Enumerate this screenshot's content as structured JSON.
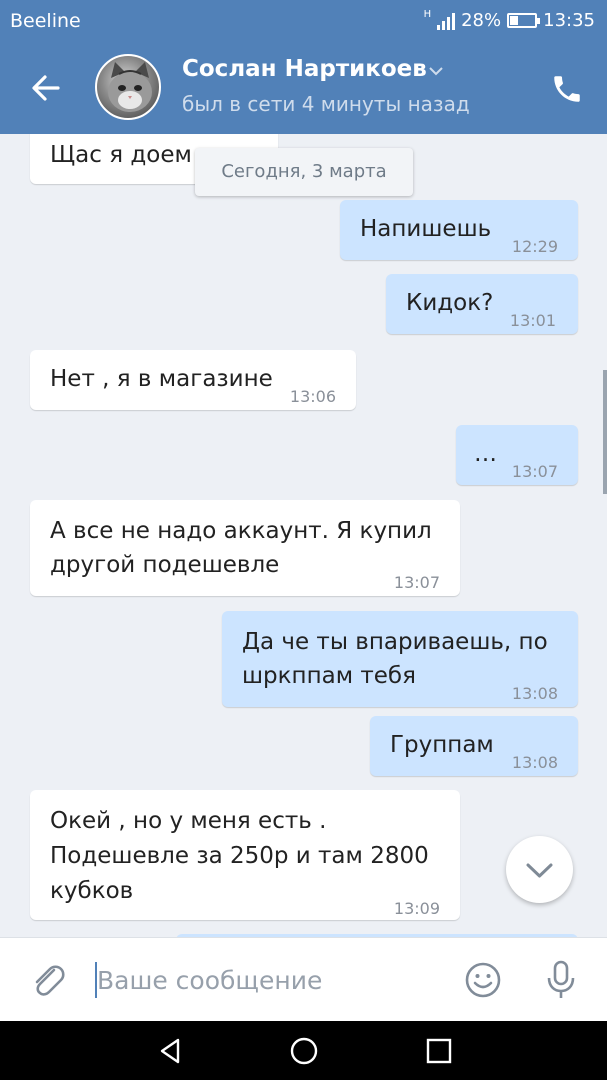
{
  "status_bar": {
    "carrier": "Beeline",
    "network": "H",
    "battery": "28%",
    "time": "13:35"
  },
  "header": {
    "contact_name": "Сослан Нартикоев",
    "last_seen": "был в сети 4 минуты назад",
    "icons": [
      "back-arrow-icon",
      "chevron-down-icon",
      "phone-icon"
    ]
  },
  "chat": {
    "date_divider": "Сегодня, 3 марта",
    "messages": [
      {
        "direction": "in",
        "lines": [
          "Щас я доем"
        ],
        "time": ""
      },
      {
        "direction": "out",
        "lines": [
          "Напишешь"
        ],
        "time": "12:29"
      },
      {
        "direction": "out",
        "lines": [
          "Кидок?"
        ],
        "time": "13:01"
      },
      {
        "direction": "in",
        "lines": [
          "Нет , я в магазине"
        ],
        "time": "13:06"
      },
      {
        "direction": "out",
        "lines": [
          "…"
        ],
        "time": "13:07"
      },
      {
        "direction": "in",
        "lines": [
          "А все не надо аккаунт. Я купил",
          "другой подешевле"
        ],
        "time": "13:07"
      },
      {
        "direction": "out",
        "lines": [
          "Да че ты впариваешь, по",
          "шркппам тебя"
        ],
        "time": "13:08"
      },
      {
        "direction": "out",
        "lines": [
          "Группам"
        ],
        "time": "13:08"
      },
      {
        "direction": "in",
        "lines": [
          "Окей , но у меня есть .",
          "Подешевле за 250р и там 2800",
          "кубков"
        ],
        "time": "13:09"
      }
    ]
  },
  "composer": {
    "placeholder": "Ваше сообщение",
    "icons": [
      "paperclip-icon",
      "smile-icon",
      "microphone-icon"
    ]
  },
  "nav_bar": {
    "icons": [
      "back-triangle-icon",
      "home-circle-icon",
      "recents-square-icon"
    ]
  },
  "colors": {
    "header": "#5181b8",
    "background": "#edf0f5",
    "bubble_in": "#ffffff",
    "bubble_out": "#cce4ff"
  }
}
